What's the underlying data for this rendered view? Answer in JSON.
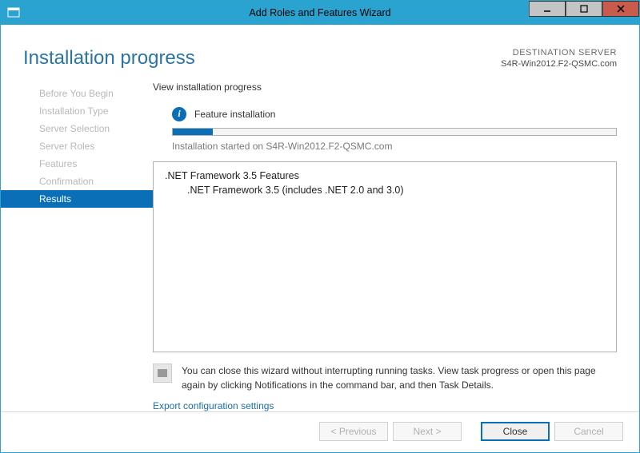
{
  "window": {
    "title": "Add Roles and Features Wizard"
  },
  "header": {
    "page_title": "Installation progress",
    "destination_label": "DESTINATION SERVER",
    "destination_server": "S4R-Win2012.F2-QSMC.com"
  },
  "sidebar": {
    "items": [
      {
        "label": "Before You Begin",
        "active": false
      },
      {
        "label": "Installation Type",
        "active": false
      },
      {
        "label": "Server Selection",
        "active": false
      },
      {
        "label": "Server Roles",
        "active": false
      },
      {
        "label": "Features",
        "active": false
      },
      {
        "label": "Confirmation",
        "active": false
      },
      {
        "label": "Results",
        "active": true
      }
    ]
  },
  "content": {
    "section_label": "View installation progress",
    "status_text": "Feature installation",
    "progress_percent": 9,
    "progress_message": "Installation started on S4R-Win2012.F2-QSMC.com",
    "feature_parent": ".NET Framework 3.5 Features",
    "feature_child": ".NET Framework 3.5 (includes .NET 2.0 and 3.0)",
    "note_text": "You can close this wizard without interrupting running tasks. View task progress or open this page again by clicking Notifications in the command bar, and then Task Details.",
    "export_link": "Export configuration settings"
  },
  "footer": {
    "previous": "< Previous",
    "next": "Next >",
    "close": "Close",
    "cancel": "Cancel"
  }
}
